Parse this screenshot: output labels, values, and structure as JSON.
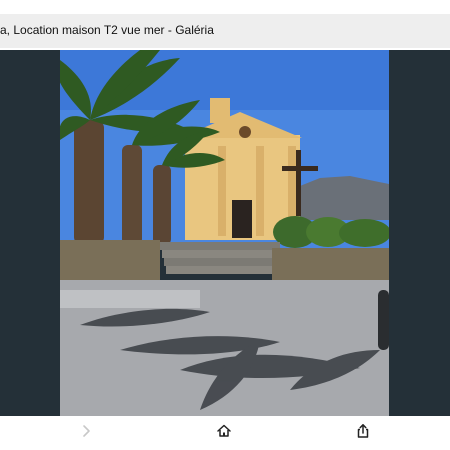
{
  "header": {
    "title": "a, Location maison T2 vue mer - Galéria"
  },
  "viewer": {
    "background_color": "#243038"
  },
  "photo": {
    "subject": "chapel-with-palm-trees"
  },
  "toolbar": {
    "items": [
      {
        "icon": "chevron-right-icon",
        "enabled": false
      },
      {
        "icon": "home-icon",
        "enabled": true
      },
      {
        "icon": "share-icon",
        "enabled": true
      }
    ]
  }
}
